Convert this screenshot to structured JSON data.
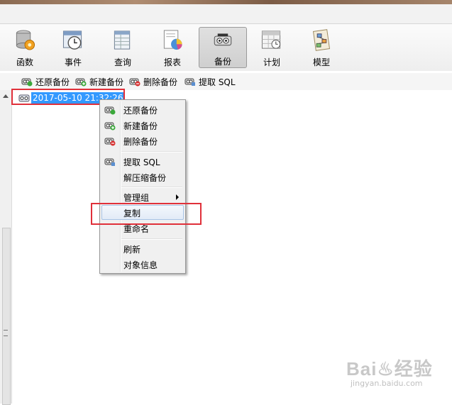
{
  "toolbar": {
    "buttons": [
      {
        "label": "函数",
        "icon": "database-function-icon"
      },
      {
        "label": "事件",
        "icon": "event-clock-icon"
      },
      {
        "label": "查询",
        "icon": "query-table-icon"
      },
      {
        "label": "报表",
        "icon": "report-chart-icon"
      },
      {
        "label": "备份",
        "icon": "backup-icon",
        "active": true
      },
      {
        "label": "计划",
        "icon": "schedule-calendar-icon"
      },
      {
        "label": "模型",
        "icon": "model-diagram-icon"
      }
    ]
  },
  "subtoolbar": {
    "restore": "还原备份",
    "new": "新建备份",
    "delete": "删除备份",
    "extract": "提取 SQL"
  },
  "tree": {
    "selected_item": "2017-05-10 21:32:26"
  },
  "context_menu": {
    "items": {
      "restore": "还原备份",
      "new": "新建备份",
      "delete": "删除备份",
      "extract": "提取 SQL",
      "decompress": "解压缩备份",
      "manage_group": "管理组",
      "copy": "复制",
      "rename": "重命名",
      "refresh": "刷新",
      "object_info": "对象信息"
    },
    "hovered": "copy"
  },
  "watermark": {
    "brand": "Bai♨经验",
    "url": "jingyan.baidu.com"
  },
  "colors": {
    "selection": "#3399ff",
    "highlight_box": "#e0303a"
  }
}
